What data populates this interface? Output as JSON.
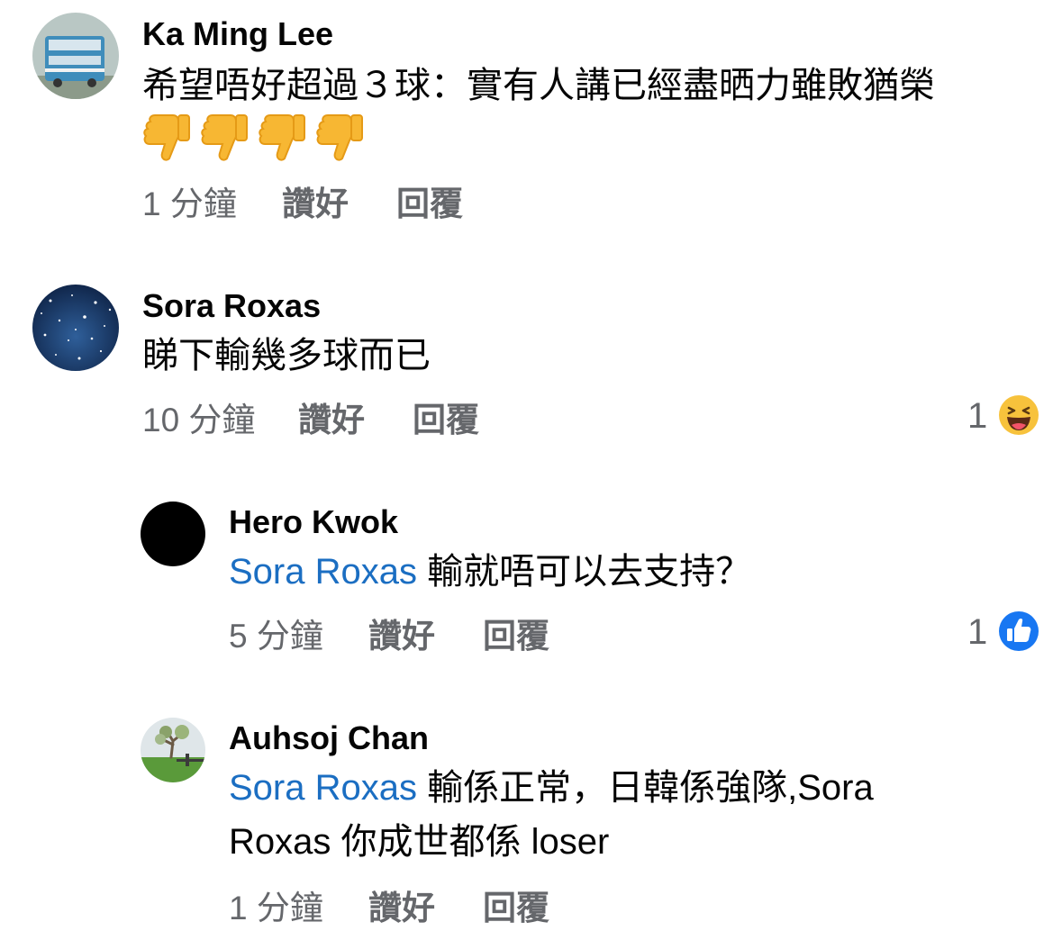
{
  "comments": [
    {
      "author": "Ka Ming Lee",
      "text": "希望唔好超過３球：實有人講已經盡晒力雖敗猶榮",
      "emoji_row": [
        "thumbs-down-icon",
        "thumbs-down-icon",
        "thumbs-down-icon",
        "thumbs-down-icon"
      ],
      "time": "1 分鐘",
      "like_label": "讚好",
      "reply_label": "回覆"
    },
    {
      "author": "Sora Roxas",
      "text": "睇下輸幾多球而已",
      "time": "10 分鐘",
      "like_label": "讚好",
      "reply_label": "回覆",
      "reaction": {
        "count": "1",
        "icon": "haha-emoji-icon"
      }
    }
  ],
  "replies": [
    {
      "author": "Hero Kwok",
      "mention": "Sora Roxas",
      "text": " 輸就唔可以去支持？",
      "time": "5 分鐘",
      "like_label": "讚好",
      "reply_label": "回覆",
      "reaction": {
        "count": "1",
        "icon": "like-icon"
      }
    },
    {
      "author": "Auhsoj Chan",
      "mention": "Sora Roxas",
      "text_line1": " 輸係正常，日韓係強隊,Sora",
      "text_line2": "Roxas 你成世都係 loser",
      "time": "1 分鐘",
      "like_label": "讚好",
      "reply_label": "回覆"
    }
  ],
  "colors": {
    "mention": "#1b6ec2",
    "meta": "#65676b",
    "like_blue": "#1877f2",
    "haha_yellow": "#f7c23c"
  }
}
